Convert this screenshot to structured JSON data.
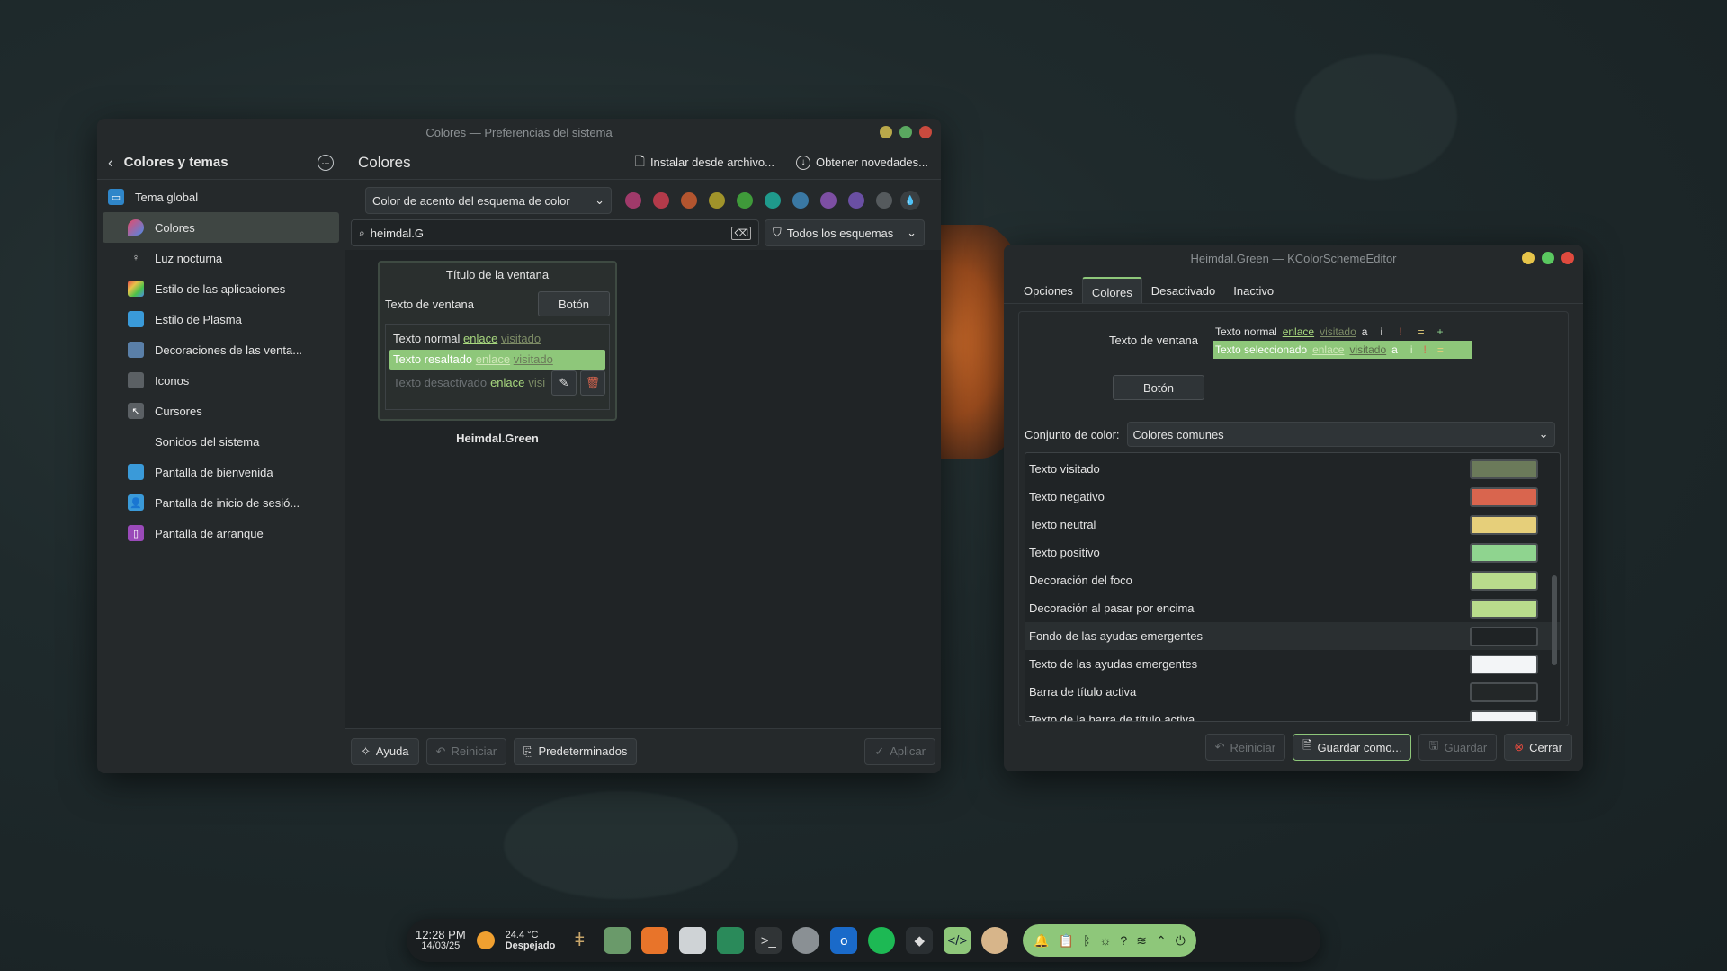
{
  "main_window": {
    "title": "Colores — Preferencias del sistema",
    "sidebar": {
      "back_label": "Colores y temas",
      "items": [
        {
          "label": "Tema global"
        },
        {
          "label": "Colores"
        },
        {
          "label": "Luz nocturna"
        },
        {
          "label": "Estilo de las aplicaciones"
        },
        {
          "label": "Estilo de Plasma"
        },
        {
          "label": "Decoraciones de las venta..."
        },
        {
          "label": "Iconos"
        },
        {
          "label": "Cursores"
        },
        {
          "label": "Sonidos del sistema"
        },
        {
          "label": "Pantalla de bienvenida"
        },
        {
          "label": "Pantalla de inicio de sesió..."
        },
        {
          "label": "Pantalla de arranque"
        }
      ]
    },
    "header": {
      "title": "Colores",
      "install_label": "Instalar desde archivo...",
      "get_new_label": "Obtener novedades..."
    },
    "accent": {
      "dropdown_value": "Color de acento del esquema de color",
      "swatches": [
        "#a03a6a",
        "#b33a4a",
        "#b3552f",
        "#a0932a",
        "#3f9a3a",
        "#1f9a8c",
        "#3a78a3",
        "#7d4fa3",
        "#6a4fa3",
        "#555a5d"
      ]
    },
    "search": {
      "value": "heimdal.G",
      "filter_label": "Todos los esquemas"
    },
    "preview": {
      "window_title": "Título de la ventana",
      "window_text": "Texto de ventana",
      "button_label": "Botón",
      "normal_text": "Texto normal",
      "link": "enlace",
      "visited": "visitado",
      "highlight_text": "Texto resaltado",
      "disabled_text": "Texto desactivado",
      "visited_cut": "visi",
      "scheme_name": "Heimdal.Green"
    },
    "footer": {
      "help_label": "Ayuda",
      "reset_label": "Reiniciar",
      "defaults_label": "Predeterminados",
      "apply_label": "Aplicar"
    }
  },
  "editor_window": {
    "title": "Heimdal.Green — KColorSchemeEditor",
    "tabs": [
      "Opciones",
      "Colores",
      "Desactivado",
      "Inactivo"
    ],
    "preview": {
      "window_text": "Texto de ventana",
      "normal_text": "Texto normal",
      "link": "enlace",
      "visited": "visitado",
      "a": "a",
      "i": "i",
      "excl": "!",
      "eq": "=",
      "plus": "+",
      "selected_text": "Texto seleccionado",
      "button_label": "Botón"
    },
    "color_set_label": "Conjunto de color:",
    "color_set_value": "Colores comunes",
    "rows": [
      {
        "label": "Texto visitado",
        "color": "#6b7a5a"
      },
      {
        "label": "Texto negativo",
        "color": "#d9654e"
      },
      {
        "label": "Texto neutral",
        "color": "#e6cf7a"
      },
      {
        "label": "Texto positivo",
        "color": "#8fd48f"
      },
      {
        "label": "Decoración del foco",
        "color": "#b9dc8c"
      },
      {
        "label": "Decoración al pasar por encima",
        "color": "#b9dc8c"
      },
      {
        "label": "Fondo de las ayudas emergentes",
        "color": "#1f2325"
      },
      {
        "label": "Texto de las ayudas emergentes",
        "color": "#f3f5f7"
      },
      {
        "label": "Barra de título activa",
        "color": "#232728"
      },
      {
        "label": "Texto de la barra de título activa",
        "color": "#f3f5f7"
      }
    ],
    "footer": {
      "reset_label": "Reiniciar",
      "save_as_label": "Guardar como...",
      "save_label": "Guardar",
      "close_label": "Cerrar"
    }
  },
  "taskbar": {
    "time": "12:28 PM",
    "date": "14/03/25",
    "temp": "24.4 °C",
    "weather": "Despejado"
  }
}
